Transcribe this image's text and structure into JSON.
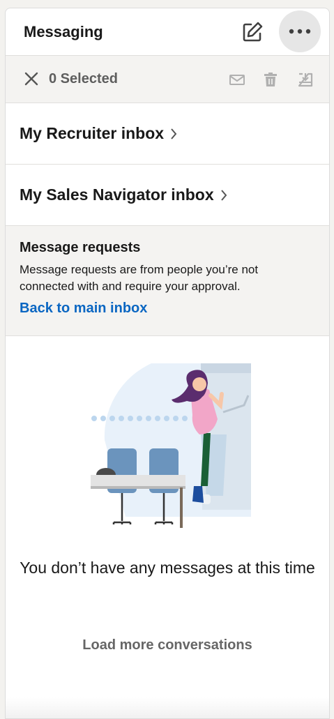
{
  "header": {
    "title": "Messaging",
    "compose_icon": "compose-icon",
    "more_icon": "more-horizontal-icon"
  },
  "selection_bar": {
    "selected_label": "0 Selected",
    "close_icon": "close-icon",
    "actions": [
      "mark-unread-icon",
      "delete-icon",
      "archive-icon"
    ]
  },
  "inbox_links": [
    {
      "label": "My Recruiter inbox"
    },
    {
      "label": "My Sales Navigator inbox"
    }
  ],
  "message_requests": {
    "title": "Message requests",
    "description": "Message requests are from people you’re not connected with and require your approval.",
    "back_link": "Back to main inbox"
  },
  "empty_state": {
    "message": "You don’t have any messages at this time",
    "load_more": "Load more conversations"
  },
  "colors": {
    "link": "#0a66c2",
    "muted": "#666666",
    "band": "#f4f3f1"
  }
}
